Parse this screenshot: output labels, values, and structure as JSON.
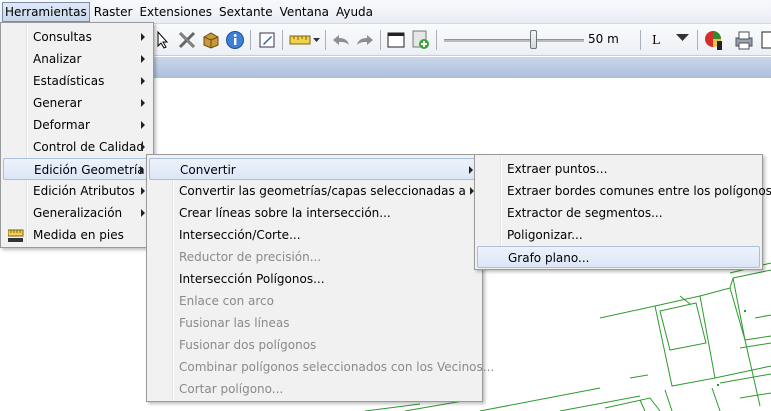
{
  "menubar": {
    "items": [
      "Herramientas",
      "Raster",
      "Extensiones",
      "Sextante",
      "Ventana",
      "Ayuda"
    ]
  },
  "toolbar": {
    "scale_label": "50 m",
    "line_label": "L",
    "slider_value_fraction": 0.64
  },
  "menus": {
    "herramientas": [
      {
        "label": "Consultas",
        "submenu": true
      },
      {
        "label": "Analizar",
        "submenu": true
      },
      {
        "label": "Estadísticas",
        "submenu": true
      },
      {
        "label": "Generar",
        "submenu": true
      },
      {
        "label": "Deformar",
        "submenu": true
      },
      {
        "label": "Control de Calidad",
        "submenu": true
      },
      {
        "label": "Edición Geometría",
        "submenu": true,
        "highlighted": true
      },
      {
        "label": "Edición Atributos",
        "submenu": true
      },
      {
        "label": "Generalización",
        "submenu": true
      },
      {
        "label": "Medida en pies",
        "icon": "ruler-feet-icon"
      }
    ],
    "edicion_geometria": [
      {
        "label": "Convertir",
        "submenu": true,
        "highlighted": true
      },
      {
        "label": "Convertir las geometrías/capas seleccionadas  a",
        "submenu": true
      },
      {
        "label": "Crear líneas sobre la intersección..."
      },
      {
        "label": "Intersección/Corte..."
      },
      {
        "label": "Reductor de precisión...",
        "disabled": true
      },
      {
        "label": "Intersección Polígonos..."
      },
      {
        "label": "Enlace con arco",
        "disabled": true
      },
      {
        "label": "Fusionar las líneas",
        "disabled": true
      },
      {
        "label": "Fusionar dos polígonos",
        "disabled": true
      },
      {
        "label": "Combinar polígonos seleccionados con los Vecinos...",
        "disabled": true
      },
      {
        "label": "Cortar polígono...",
        "disabled": true
      }
    ],
    "convertir": [
      {
        "label": "Extraer puntos..."
      },
      {
        "label": "Extraer bordes comunes entre los polígonos..."
      },
      {
        "label": "Extractor de segmentos..."
      },
      {
        "label": "Poligonizar..."
      },
      {
        "label": "Grafo plano...",
        "highlighted": true
      }
    ]
  },
  "colors": {
    "map_lines": "#2e9a2e",
    "menu_bg": "#f1f1f1",
    "highlight": "#dbe6f6",
    "disabled_text": "#8a8a8a"
  }
}
